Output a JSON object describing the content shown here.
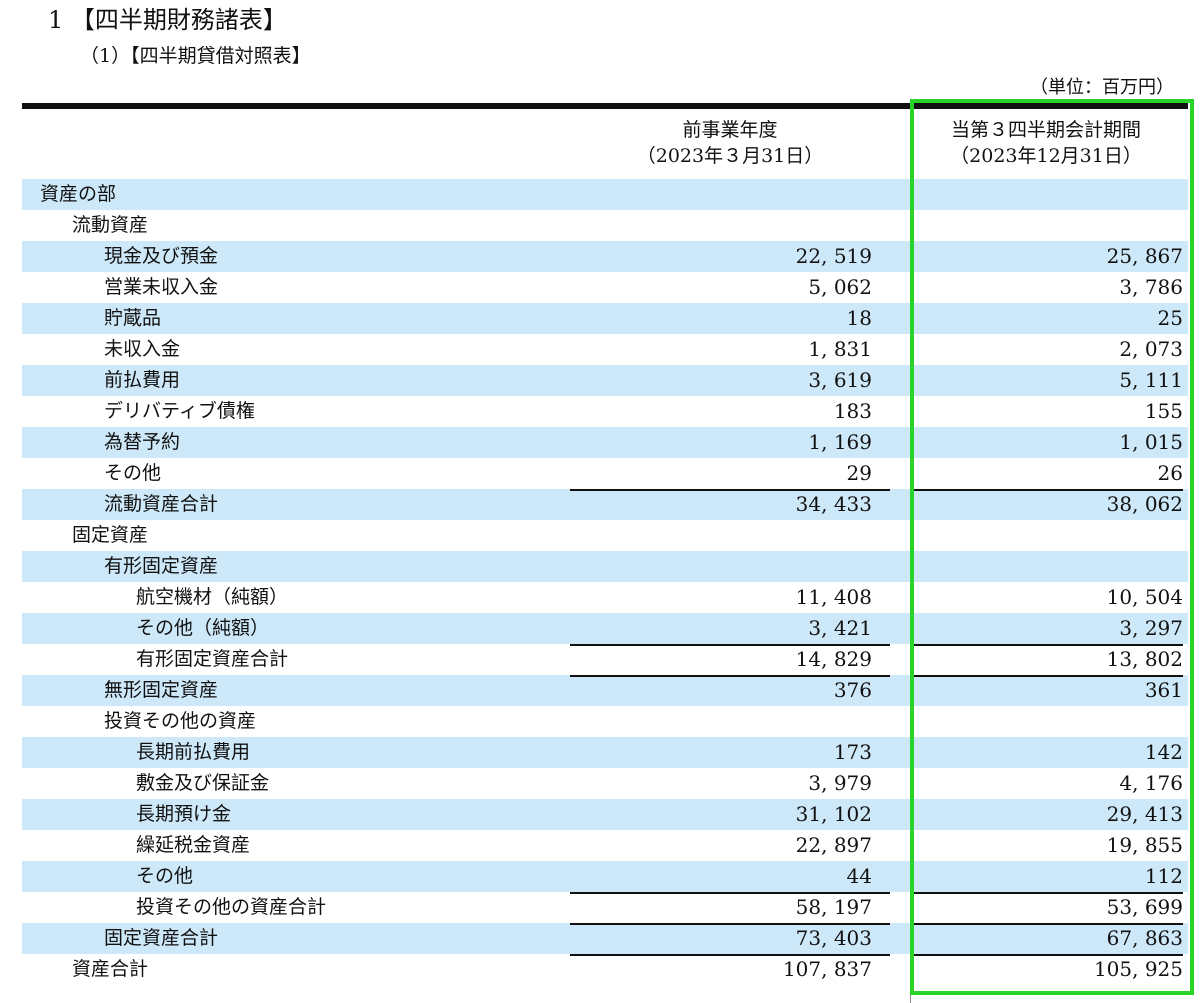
{
  "heading": "1 【四半期財務諸表】",
  "subheading": "（1）【四半期貸借対照表】",
  "unit": "（単位：百万円）",
  "columns": {
    "prev_title": "前事業年度",
    "prev_date": "（2023年３月31日）",
    "curr_title": "当第３四半期会計期間",
    "curr_date": "（2023年12月31日）"
  },
  "highlight_color": "#27d427",
  "rows": [
    {
      "label": "資産の部",
      "prev": "",
      "curr": ""
    },
    {
      "label": "流動資産",
      "prev": "",
      "curr": ""
    },
    {
      "label": "現金及び預金",
      "prev": "22, 519",
      "curr": "25, 867"
    },
    {
      "label": "営業未収入金",
      "prev": "5, 062",
      "curr": "3, 786"
    },
    {
      "label": "貯蔵品",
      "prev": "18",
      "curr": "25"
    },
    {
      "label": "未収入金",
      "prev": "1, 831",
      "curr": "2, 073"
    },
    {
      "label": "前払費用",
      "prev": "3, 619",
      "curr": "5, 111"
    },
    {
      "label": "デリバティブ債権",
      "prev": "183",
      "curr": "155"
    },
    {
      "label": "為替予約",
      "prev": "1, 169",
      "curr": "1, 015"
    },
    {
      "label": "その他",
      "prev": "29",
      "curr": "26"
    },
    {
      "label": "流動資産合計",
      "prev": "34, 433",
      "curr": "38, 062"
    },
    {
      "label": "固定資産",
      "prev": "",
      "curr": ""
    },
    {
      "label": "有形固定資産",
      "prev": "",
      "curr": ""
    },
    {
      "label": "航空機材（純額）",
      "prev": "11, 408",
      "curr": "10, 504"
    },
    {
      "label": "その他（純額）",
      "prev": "3, 421",
      "curr": "3, 297"
    },
    {
      "label": "有形固定資産合計",
      "prev": "14, 829",
      "curr": "13, 802"
    },
    {
      "label": "無形固定資産",
      "prev": "376",
      "curr": "361"
    },
    {
      "label": "投資その他の資産",
      "prev": "",
      "curr": ""
    },
    {
      "label": "長期前払費用",
      "prev": "173",
      "curr": "142"
    },
    {
      "label": "敷金及び保証金",
      "prev": "3, 979",
      "curr": "4, 176"
    },
    {
      "label": "長期預け金",
      "prev": "31, 102",
      "curr": "29, 413"
    },
    {
      "label": "繰延税金資産",
      "prev": "22, 897",
      "curr": "19, 855"
    },
    {
      "label": "その他",
      "prev": "44",
      "curr": "112"
    },
    {
      "label": "投資その他の資産合計",
      "prev": "58, 197",
      "curr": "53, 699"
    },
    {
      "label": "固定資産合計",
      "prev": "73, 403",
      "curr": "67, 863"
    },
    {
      "label": "資産合計",
      "prev": "107, 837",
      "curr": "105, 925"
    }
  ]
}
